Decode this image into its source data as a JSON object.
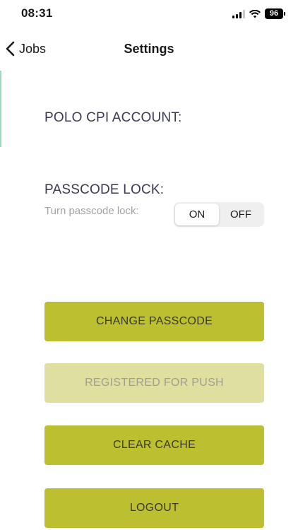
{
  "status_bar": {
    "time": "08:31",
    "battery": "96",
    "icons": [
      "signal-icon",
      "wifi-icon",
      "battery-icon"
    ]
  },
  "nav": {
    "back_label": "Jobs",
    "title": "Settings"
  },
  "account": {
    "heading": "POLO CPI ACCOUNT:"
  },
  "passcode": {
    "heading": "PASSCODE LOCK:",
    "sub_label": "Turn passcode lock:",
    "options": [
      "ON",
      "OFF"
    ],
    "selected": "ON"
  },
  "buttons": {
    "change_passcode": "CHANGE PASSCODE",
    "registered_push": "REGISTERED FOR PUSH",
    "clear_cache": "CLEAR CACHE",
    "logout": "LOGOUT"
  },
  "colors": {
    "primary_button": "#bcbf2f",
    "disabled_button": "#dfe09f",
    "heading_text": "#3a3a55",
    "accent_line": "#9fd9bd"
  }
}
